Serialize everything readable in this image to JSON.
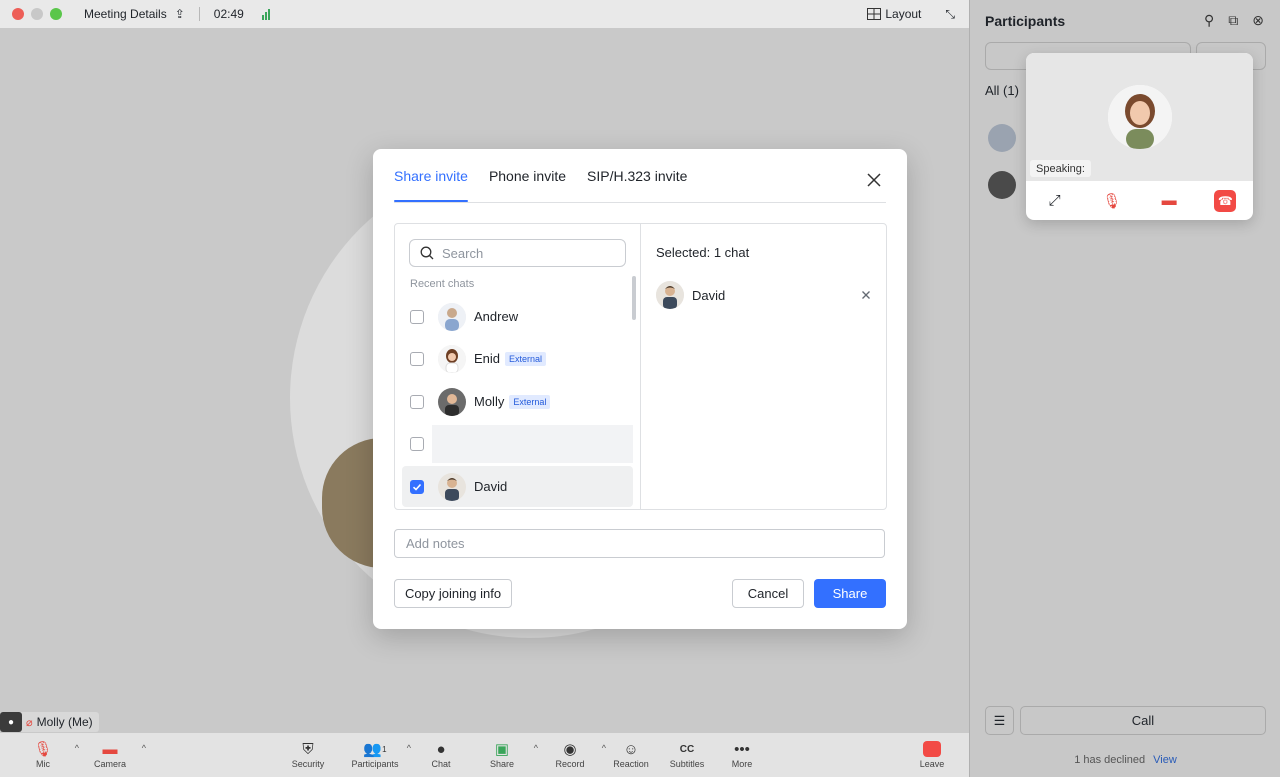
{
  "window": {
    "meeting_title": "Meeting Details",
    "timer": "02:49",
    "layout_label": "Layout"
  },
  "self_tag": {
    "name": "Molly (Me)"
  },
  "toolbar": {
    "mic": "Mic",
    "camera": "Camera",
    "security": "Security",
    "participants": "Participants",
    "participants_count": "1",
    "chat": "Chat",
    "share": "Share",
    "record": "Record",
    "reaction": "Reaction",
    "subtitles": "Subtitles",
    "more": "More",
    "leave": "Leave"
  },
  "panel": {
    "title": "Participants",
    "all_label": "All (1)",
    "call_label": "Call",
    "declined_text": "1 has declined",
    "view_link": "View"
  },
  "mini": {
    "speaking_label": "Speaking:"
  },
  "dialog": {
    "tabs": [
      {
        "label": "Share invite",
        "active": true
      },
      {
        "label": "Phone invite",
        "active": false
      },
      {
        "label": "SIP/H.323 invite",
        "active": false
      }
    ],
    "search_placeholder": "Search",
    "recent_label": "Recent chats",
    "contacts": [
      {
        "name": "Andrew",
        "external": "",
        "checked": false
      },
      {
        "name": "Enid",
        "external": "External",
        "checked": false
      },
      {
        "name": "Molly",
        "external": "External",
        "checked": false
      },
      {
        "name": "",
        "external": "",
        "checked": false
      },
      {
        "name": "David",
        "external": "",
        "checked": true
      }
    ],
    "selected_title": "Selected: 1 chat",
    "selected_items": [
      {
        "name": "David"
      }
    ],
    "notes_placeholder": "Add notes",
    "copy_button": "Copy joining info",
    "cancel_button": "Cancel",
    "share_button": "Share"
  },
  "colors": {
    "accent": "#3370ff",
    "external_badge_bg": "#e1eaff",
    "hangup": "#f24a45"
  }
}
